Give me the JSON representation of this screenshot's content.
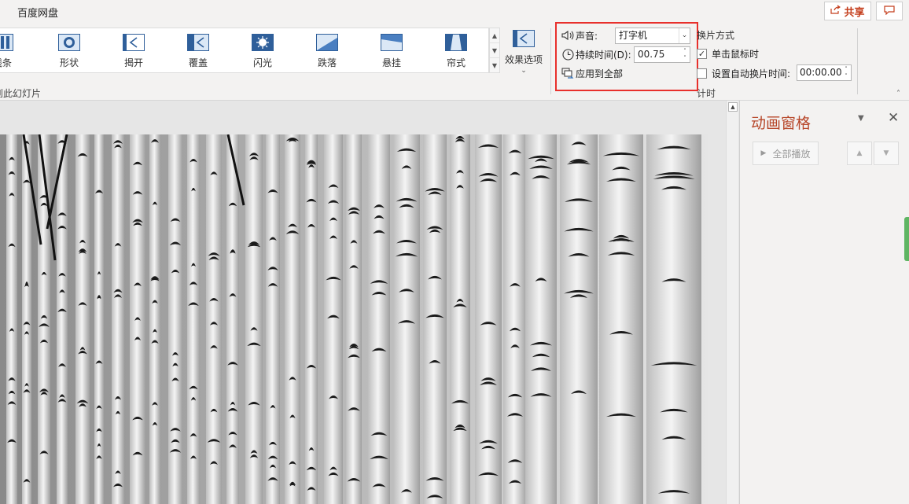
{
  "app": {
    "tab_label": "百度网盘",
    "share_label": "共享",
    "share_icon": "share-icon",
    "comment_icon": "comment-icon"
  },
  "transitions": {
    "items": [
      {
        "label": "线条",
        "icon": "lines-icon"
      },
      {
        "label": "形状",
        "icon": "shape-icon"
      },
      {
        "label": "揭开",
        "icon": "uncover-icon"
      },
      {
        "label": "覆盖",
        "icon": "cover-icon"
      },
      {
        "label": "闪光",
        "icon": "flash-icon"
      },
      {
        "label": "跌落",
        "icon": "fall-icon"
      },
      {
        "label": "悬挂",
        "icon": "drape-icon"
      },
      {
        "label": "帘式",
        "icon": "curtains-icon"
      }
    ],
    "group_label": "切换到此幻灯片",
    "effect_options_label": "效果选项"
  },
  "timing": {
    "sound_label": "声音:",
    "sound_value": "打字机",
    "duration_label": "持续时间(D):",
    "duration_value": "00.75",
    "apply_all_label": "应用到全部",
    "advance_title": "换片方式",
    "on_click_label": "单击鼠标时",
    "on_click_checked": true,
    "auto_label": "设置自动换片时间:",
    "auto_checked": false,
    "auto_value": "00:00.00",
    "group_label": "计时",
    "highlight_color": "#e8302c"
  },
  "anim_pane": {
    "title": "动画窗格",
    "play_all_label": "全部播放",
    "title_color": "#b7472a"
  }
}
